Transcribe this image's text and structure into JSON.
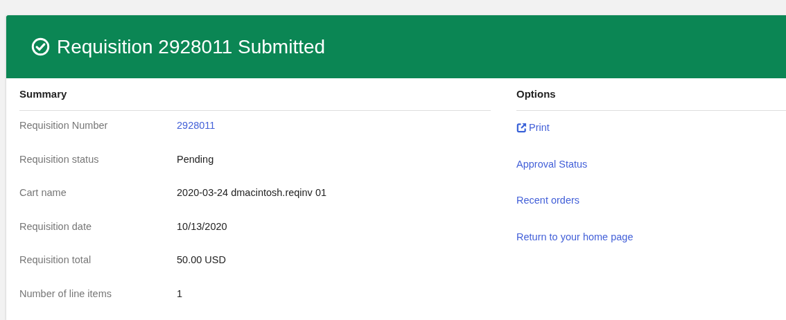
{
  "header": {
    "title": "Requisition 2928011 Submitted"
  },
  "summary": {
    "heading": "Summary",
    "rows": [
      {
        "label": "Requisition Number",
        "value": "2928011",
        "kind": "link"
      },
      {
        "label": "Requisition status",
        "value": "Pending",
        "kind": "text"
      },
      {
        "label": "Cart name",
        "value": "2020-03-24 dmacintosh.reqinv 01",
        "kind": "text"
      },
      {
        "label": "Requisition date",
        "value": "10/13/2020",
        "kind": "text"
      },
      {
        "label": "Requisition total",
        "value": "50.00 USD",
        "kind": "text"
      },
      {
        "label": "Number of line items",
        "value": "1",
        "kind": "text"
      }
    ]
  },
  "options": {
    "heading": "Options",
    "links": [
      {
        "label": "Print",
        "kind": "external"
      },
      {
        "label": "Approval Status",
        "kind": "plain"
      },
      {
        "label": "Recent orders",
        "kind": "plain"
      },
      {
        "label": "Return to your home page",
        "kind": "plain"
      }
    ]
  }
}
